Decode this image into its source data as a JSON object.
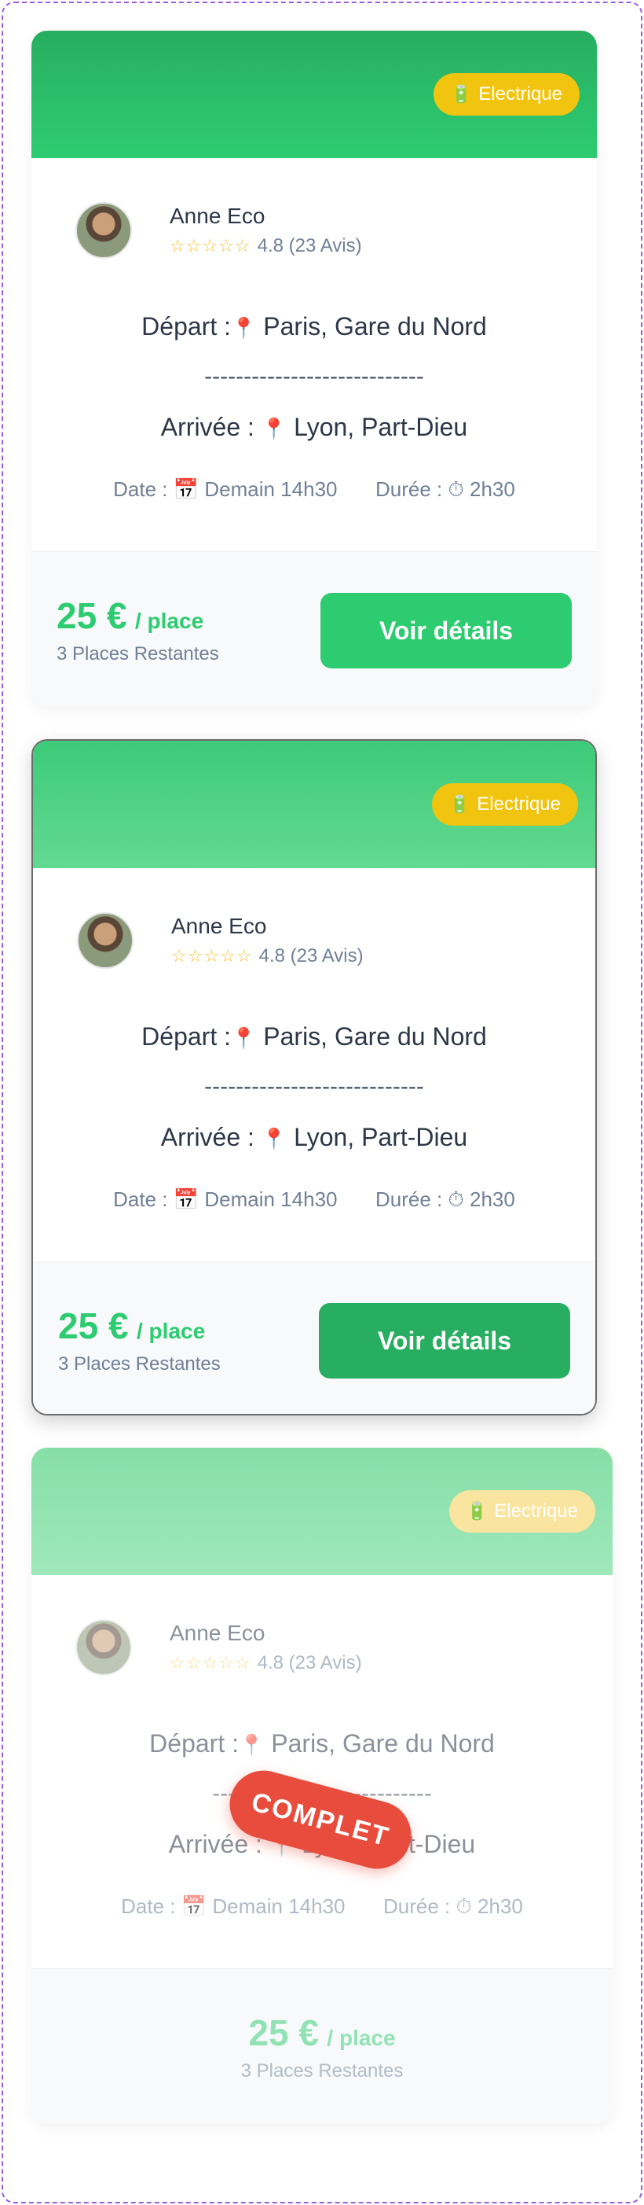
{
  "cards": [
    {
      "badge": "Electrique",
      "driver": {
        "name": "Anne Eco",
        "stars": "☆☆☆☆☆",
        "rating": "4.8 (23 Avis)"
      },
      "departure": {
        "label": "Départ :",
        "place": "Paris, Gare du Nord"
      },
      "separator": "----------------------------",
      "arrival": {
        "label": "Arrivée :",
        "place": "Lyon, Part-Dieu"
      },
      "date": {
        "label": "Date :",
        "value": "Demain 14h30"
      },
      "duration": {
        "label": "Durée :",
        "value": "2h30"
      },
      "price": {
        "amount": "25 €",
        "unit": "/ place"
      },
      "places": "3 Places Restantes",
      "button": "Voir détails"
    },
    {
      "badge": "Electrique",
      "driver": {
        "name": "Anne Eco",
        "stars": "☆☆☆☆☆",
        "rating": "4.8 (23 Avis)"
      },
      "departure": {
        "label": "Départ :",
        "place": "Paris, Gare du Nord"
      },
      "separator": "----------------------------",
      "arrival": {
        "label": "Arrivée :",
        "place": "Lyon, Part-Dieu"
      },
      "date": {
        "label": "Date :",
        "value": "Demain 14h30"
      },
      "duration": {
        "label": "Durée :",
        "value": "2h30"
      },
      "price": {
        "amount": "25 €",
        "unit": "/ place"
      },
      "places": "3 Places Restantes",
      "button": "Voir détails"
    },
    {
      "badge": "Electrique",
      "driver": {
        "name": "Anne Eco",
        "stars": "☆☆☆☆☆",
        "rating": "4.8 (23 Avis)"
      },
      "departure": {
        "label": "Départ :",
        "place": "Paris, Gare du Nord"
      },
      "separator": "----------------------------",
      "arrival": {
        "label": "Arrivée :",
        "place": "Lyon, Part-Dieu"
      },
      "date": {
        "label": "Date :",
        "value": "Demain 14h30"
      },
      "duration": {
        "label": "Durée :",
        "value": "2h30"
      },
      "price": {
        "amount": "25 €",
        "unit": "/ place"
      },
      "places": "3 Places Restantes",
      "stamp": "COMPLET"
    }
  ],
  "icons": {
    "badge": "battery-icon",
    "pin": "map-pin-icon",
    "calendar": "calendar-icon",
    "timer": "stopwatch-icon"
  },
  "colors": {
    "primary": "#2ecc71",
    "primary_dark": "#27ae60",
    "badge": "#f1c40f",
    "stamp": "#e74c3c",
    "frame": "#9b5de5"
  }
}
